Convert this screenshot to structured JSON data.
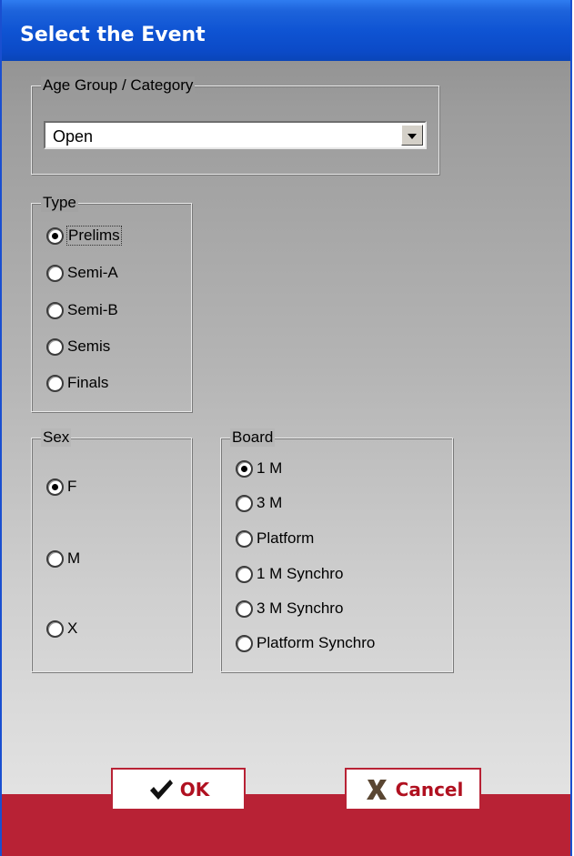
{
  "window": {
    "title": "Select the Event"
  },
  "age_group": {
    "legend": "Age Group / Category",
    "selected": "Open"
  },
  "type": {
    "legend": "Type",
    "options": [
      "Prelims",
      "Semi-A",
      "Semi-B",
      "Semis",
      "Finals"
    ],
    "selected": "Prelims"
  },
  "sex": {
    "legend": "Sex",
    "options": [
      "F",
      "M",
      "X"
    ],
    "selected": "F"
  },
  "board": {
    "legend": "Board",
    "options": [
      "1 M",
      "3 M",
      "Platform",
      "1 M Synchro",
      "3 M Synchro",
      "Platform Synchro"
    ],
    "selected": "1 M"
  },
  "buttons": {
    "ok_label": "OK",
    "cancel_label": "Cancel"
  },
  "colors": {
    "title_blue": "#0f54d3",
    "accent_red": "#b82235"
  },
  "icons": {
    "ok": "checkmark-icon",
    "cancel": "x-icon",
    "dropdown": "chevron-down-icon"
  }
}
